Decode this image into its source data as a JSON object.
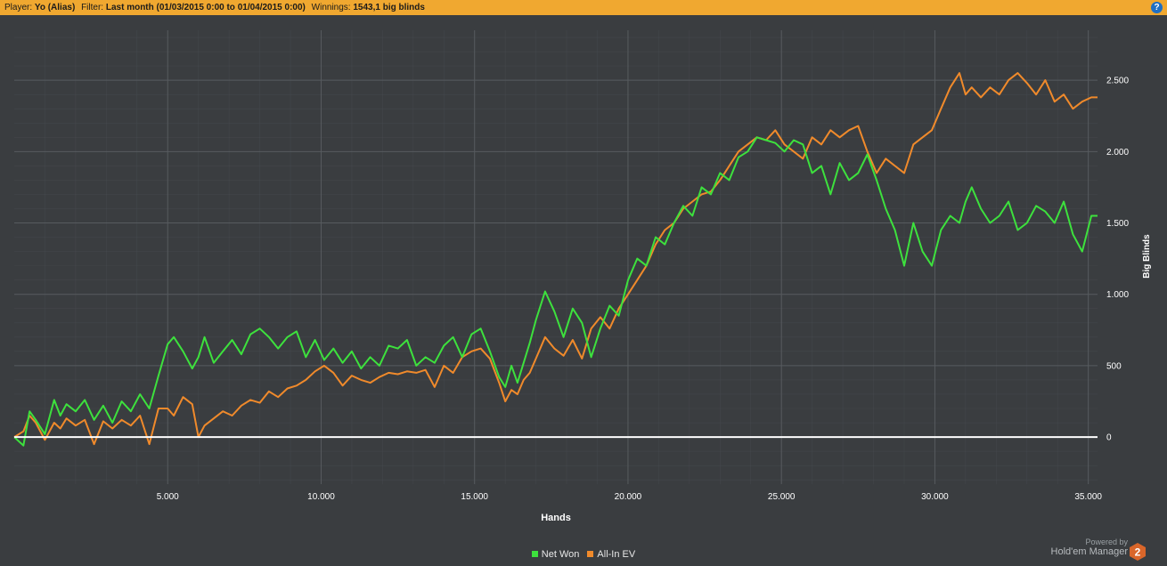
{
  "header": {
    "player_label": "Player:",
    "player_value": "Yo (Alias)",
    "filter_label": "Filter:",
    "filter_value": "Last month (01/03/2015 0:00 to 01/04/2015 0:00)",
    "winnings_label": "Winnings:",
    "winnings_value": "1543,1 big blinds",
    "help_icon": "question-circle-icon",
    "help_glyph": "?"
  },
  "brand": {
    "powered_by": "Powered by",
    "name": "Hold'em Manager",
    "badge_text": "2",
    "badge_icon": "hem2-hexagon-logo"
  },
  "colors": {
    "background": "#3a3d40",
    "grid": "#4b4f53",
    "topbar": "#f0a830",
    "zero_line": "#ffffff",
    "net_won": "#3de13d",
    "all_in_ev": "#f08a2b"
  },
  "chart_data": {
    "type": "line",
    "xlabel": "Hands",
    "ylabel": "Big Blinds",
    "xlim": [
      0,
      35300
    ],
    "ylim": [
      -330,
      2850
    ],
    "x_ticks": [
      5000,
      10000,
      15000,
      20000,
      25000,
      30000,
      35000
    ],
    "x_tick_labels": [
      "5.000",
      "10.000",
      "15.000",
      "20.000",
      "25.000",
      "30.000",
      "35.000"
    ],
    "y_ticks": [
      0,
      500,
      1000,
      1500,
      2000,
      2500
    ],
    "y_tick_labels": [
      "0",
      "500",
      "1.000",
      "1.500",
      "2.000",
      "2.500"
    ],
    "y_axis_position": "right",
    "grid": true,
    "legend_position": "bottom-center",
    "series": [
      {
        "name": "Net Won",
        "color": "#3de13d",
        "x": [
          0,
          300,
          500,
          700,
          1000,
          1300,
          1500,
          1700,
          2000,
          2300,
          2600,
          2900,
          3200,
          3500,
          3800,
          4100,
          4400,
          4700,
          5000,
          5200,
          5500,
          5800,
          6000,
          6200,
          6500,
          6800,
          7100,
          7400,
          7700,
          8000,
          8300,
          8600,
          8900,
          9200,
          9500,
          9800,
          10100,
          10400,
          10700,
          11000,
          11300,
          11600,
          11900,
          12200,
          12500,
          12800,
          13100,
          13400,
          13700,
          14000,
          14300,
          14600,
          14900,
          15200,
          15500,
          15800,
          16000,
          16200,
          16400,
          16600,
          16800,
          17000,
          17300,
          17600,
          17900,
          18200,
          18500,
          18800,
          19100,
          19400,
          19700,
          20000,
          20300,
          20600,
          20900,
          21200,
          21500,
          21800,
          22100,
          22400,
          22700,
          23000,
          23300,
          23600,
          23900,
          24200,
          24500,
          24800,
          25100,
          25400,
          25700,
          26000,
          26300,
          26600,
          26900,
          27200,
          27500,
          27800,
          28100,
          28400,
          28700,
          29000,
          29300,
          29600,
          29900,
          30200,
          30500,
          30800,
          31000,
          31200,
          31500,
          31800,
          32100,
          32400,
          32700,
          33000,
          33300,
          33600,
          33900,
          34200,
          34500,
          34800,
          35100,
          35300
        ],
        "y": [
          0,
          -60,
          180,
          120,
          20,
          260,
          150,
          230,
          180,
          260,
          120,
          220,
          100,
          250,
          180,
          300,
          200,
          430,
          650,
          700,
          600,
          480,
          560,
          700,
          520,
          600,
          680,
          580,
          720,
          760,
          700,
          620,
          700,
          740,
          560,
          680,
          540,
          620,
          520,
          600,
          480,
          560,
          500,
          640,
          620,
          680,
          500,
          560,
          520,
          640,
          700,
          560,
          720,
          760,
          600,
          420,
          350,
          500,
          380,
          520,
          660,
          820,
          1020,
          880,
          700,
          900,
          800,
          560,
          760,
          920,
          850,
          1100,
          1250,
          1200,
          1400,
          1350,
          1500,
          1620,
          1550,
          1750,
          1700,
          1850,
          1800,
          1960,
          2000,
          2100,
          2080,
          2060,
          2000,
          2080,
          2050,
          1850,
          1900,
          1700,
          1920,
          1800,
          1850,
          1980,
          1800,
          1600,
          1450,
          1200,
          1500,
          1300,
          1200,
          1450,
          1550,
          1500,
          1650,
          1750,
          1600,
          1500,
          1550,
          1650,
          1450,
          1500,
          1620,
          1580,
          1500,
          1650,
          1420,
          1300,
          1550,
          1550
        ]
      },
      {
        "name": "All-In EV",
        "color": "#f08a2b",
        "x": [
          0,
          300,
          500,
          700,
          1000,
          1300,
          1500,
          1700,
          2000,
          2300,
          2600,
          2900,
          3200,
          3500,
          3800,
          4100,
          4400,
          4700,
          5000,
          5200,
          5500,
          5800,
          6000,
          6200,
          6500,
          6800,
          7100,
          7400,
          7700,
          8000,
          8300,
          8600,
          8900,
          9200,
          9500,
          9800,
          10100,
          10400,
          10700,
          11000,
          11300,
          11600,
          11900,
          12200,
          12500,
          12800,
          13100,
          13400,
          13700,
          14000,
          14300,
          14600,
          14900,
          15200,
          15500,
          15800,
          16000,
          16200,
          16400,
          16600,
          16800,
          17000,
          17300,
          17600,
          17900,
          18200,
          18500,
          18800,
          19100,
          19400,
          19700,
          20000,
          20300,
          20600,
          20900,
          21200,
          21500,
          21800,
          22100,
          22400,
          22700,
          23000,
          23300,
          23600,
          23900,
          24200,
          24500,
          24800,
          25100,
          25400,
          25700,
          26000,
          26300,
          26600,
          26900,
          27200,
          27500,
          27800,
          28100,
          28400,
          28700,
          29000,
          29300,
          29600,
          29900,
          30200,
          30500,
          30800,
          31000,
          31200,
          31500,
          31800,
          32100,
          32400,
          32700,
          33000,
          33300,
          33600,
          33900,
          34200,
          34500,
          34800,
          35100,
          35300
        ],
        "y": [
          0,
          40,
          150,
          100,
          -20,
          100,
          60,
          130,
          80,
          120,
          -50,
          110,
          60,
          120,
          80,
          150,
          -50,
          200,
          200,
          150,
          280,
          230,
          0,
          80,
          130,
          180,
          150,
          220,
          260,
          240,
          320,
          280,
          340,
          360,
          400,
          460,
          500,
          450,
          360,
          430,
          400,
          380,
          420,
          450,
          440,
          460,
          450,
          470,
          350,
          500,
          450,
          560,
          600,
          620,
          550,
          380,
          250,
          330,
          300,
          400,
          450,
          550,
          700,
          620,
          570,
          680,
          550,
          760,
          840,
          760,
          900,
          1000,
          1100,
          1200,
          1350,
          1450,
          1500,
          1600,
          1650,
          1700,
          1720,
          1800,
          1900,
          2000,
          2050,
          2100,
          2080,
          2150,
          2050,
          2000,
          1950,
          2100,
          2050,
          2150,
          2100,
          2150,
          2180,
          2000,
          1850,
          1950,
          1900,
          1850,
          2050,
          2100,
          2150,
          2300,
          2450,
          2550,
          2400,
          2450,
          2380,
          2450,
          2400,
          2500,
          2550,
          2480,
          2400,
          2500,
          2350,
          2400,
          2300,
          2350,
          2380,
          2380
        ]
      }
    ]
  }
}
